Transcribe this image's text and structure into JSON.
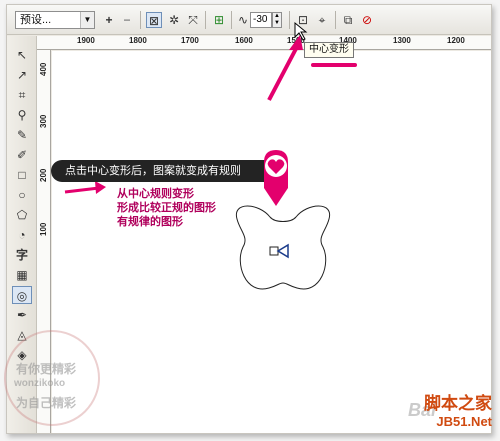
{
  "toolbar": {
    "preset_value": "预设...",
    "plus_icon": "plus-icon",
    "minus_icon": "minus-icon",
    "amount_value": "-30",
    "tooltip": "中心变形"
  },
  "hruler": {
    "labels": [
      "1900",
      "1800",
      "1700",
      "1600",
      "1500",
      "1400",
      "1300",
      "1200"
    ]
  },
  "vruler": {
    "labels": [
      "400",
      "300",
      "200",
      "100"
    ]
  },
  "callout": {
    "text": "点击中心变形后，图案就变成有规则"
  },
  "note": {
    "lines": [
      "从中心规则变形",
      "形成比较正规的图形",
      "有规律的图形"
    ]
  },
  "colors": {
    "accent": "#e3006d",
    "callout_bg": "#232323",
    "note": "#b0005c"
  },
  "watermark": {
    "line1": "有你更精彩",
    "line2": "wonzikoko",
    "line3": "为自己精彩"
  },
  "site": {
    "name": "脚本之家",
    "domain": "JB51.Net",
    "baidu": "Bai"
  }
}
